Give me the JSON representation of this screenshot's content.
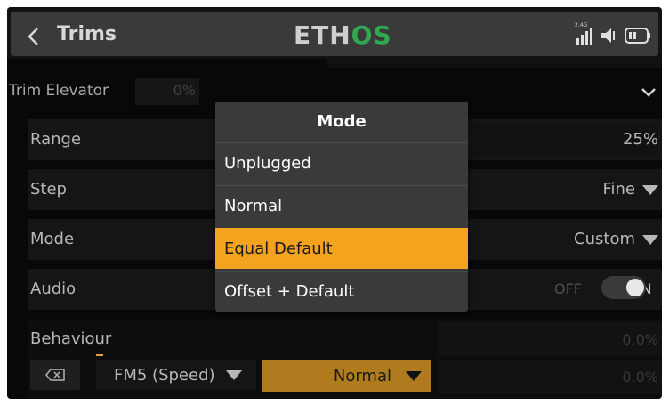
{
  "header": {
    "title": "Trims",
    "logo_left": "ETH",
    "logo_os": "OS",
    "signal_label": "2.4G"
  },
  "trim_row": {
    "label": "Trim Elevator",
    "value": "0%"
  },
  "rows": {
    "range": {
      "label": "Range",
      "value": "25%"
    },
    "step": {
      "label": "Step",
      "value": "Fine"
    },
    "mode": {
      "label": "Mode",
      "value": "Custom"
    },
    "audio": {
      "label": "Audio",
      "off": "OFF",
      "on": "ON"
    },
    "behaviour": {
      "label": "Behaviour",
      "value1": "0.0%",
      "value2": "0.0%"
    }
  },
  "behaviour_controls": {
    "flight_mode": "FM5 (Speed)",
    "mode": "Normal"
  },
  "popup": {
    "title": "Mode",
    "options": [
      "Unplugged",
      "Normal",
      "Equal Default",
      "Offset + Default"
    ],
    "selected": "Equal Default"
  },
  "colors": {
    "accent": "#f3a31e",
    "logo_green": "#2fa84f",
    "background": "#080808"
  }
}
